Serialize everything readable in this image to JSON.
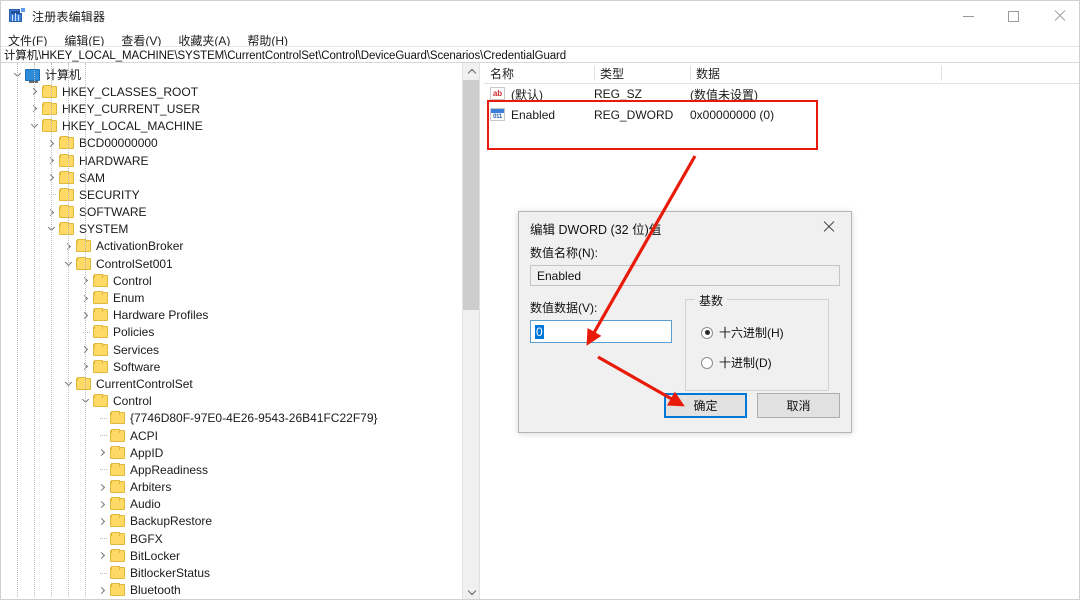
{
  "window": {
    "title": "注册表编辑器",
    "icon": "registry-editor-icon",
    "minimize_label": "最小化",
    "maximize_label": "最大化",
    "close_label": "关闭"
  },
  "menubar": {
    "items": [
      {
        "label": "文件(F)"
      },
      {
        "label": "编辑(E)"
      },
      {
        "label": "查看(V)"
      },
      {
        "label": "收藏夹(A)"
      },
      {
        "label": "帮助(H)"
      }
    ]
  },
  "address": {
    "path": "计算机\\HKEY_LOCAL_MACHINE\\SYSTEM\\CurrentControlSet\\Control\\DeviceGuard\\Scenarios\\CredentialGuard"
  },
  "tree": {
    "items": [
      {
        "label": "计算机",
        "depth": 0,
        "icon": "computer-icon",
        "state": "expanded"
      },
      {
        "label": "HKEY_CLASSES_ROOT",
        "depth": 1,
        "icon": "folder-icon",
        "state": "collapsed"
      },
      {
        "label": "HKEY_CURRENT_USER",
        "depth": 1,
        "icon": "folder-icon",
        "state": "collapsed"
      },
      {
        "label": "HKEY_LOCAL_MACHINE",
        "depth": 1,
        "icon": "folder-icon",
        "state": "expanded"
      },
      {
        "label": "BCD00000000",
        "depth": 2,
        "icon": "folder-icon",
        "state": "collapsed"
      },
      {
        "label": "HARDWARE",
        "depth": 2,
        "icon": "folder-icon",
        "state": "collapsed"
      },
      {
        "label": "SAM",
        "depth": 2,
        "icon": "folder-icon",
        "state": "collapsed"
      },
      {
        "label": "SECURITY",
        "depth": 2,
        "icon": "folder-icon",
        "state": "leaf"
      },
      {
        "label": "SOFTWARE",
        "depth": 2,
        "icon": "folder-icon",
        "state": "collapsed"
      },
      {
        "label": "SYSTEM",
        "depth": 2,
        "icon": "folder-icon",
        "state": "expanded"
      },
      {
        "label": "ActivationBroker",
        "depth": 3,
        "icon": "folder-icon",
        "state": "collapsed"
      },
      {
        "label": "ControlSet001",
        "depth": 3,
        "icon": "folder-icon",
        "state": "expanded"
      },
      {
        "label": "Control",
        "depth": 4,
        "icon": "folder-icon",
        "state": "collapsed"
      },
      {
        "label": "Enum",
        "depth": 4,
        "icon": "folder-icon",
        "state": "collapsed"
      },
      {
        "label": "Hardware Profiles",
        "depth": 4,
        "icon": "folder-icon",
        "state": "collapsed"
      },
      {
        "label": "Policies",
        "depth": 4,
        "icon": "folder-icon",
        "state": "leaf"
      },
      {
        "label": "Services",
        "depth": 4,
        "icon": "folder-icon",
        "state": "collapsed"
      },
      {
        "label": "Software",
        "depth": 4,
        "icon": "folder-icon",
        "state": "collapsed"
      },
      {
        "label": "CurrentControlSet",
        "depth": 3,
        "icon": "folder-icon",
        "state": "expanded"
      },
      {
        "label": "Control",
        "depth": 4,
        "icon": "folder-icon",
        "state": "expanded"
      },
      {
        "label": "{7746D80F-97E0-4E26-9543-26B41FC22F79}",
        "depth": 5,
        "icon": "folder-icon",
        "state": "leaf"
      },
      {
        "label": "ACPI",
        "depth": 5,
        "icon": "folder-icon",
        "state": "leaf"
      },
      {
        "label": "AppID",
        "depth": 5,
        "icon": "folder-icon",
        "state": "collapsed"
      },
      {
        "label": "AppReadiness",
        "depth": 5,
        "icon": "folder-icon",
        "state": "leaf"
      },
      {
        "label": "Arbiters",
        "depth": 5,
        "icon": "folder-icon",
        "state": "collapsed"
      },
      {
        "label": "Audio",
        "depth": 5,
        "icon": "folder-icon",
        "state": "collapsed"
      },
      {
        "label": "BackupRestore",
        "depth": 5,
        "icon": "folder-icon",
        "state": "collapsed"
      },
      {
        "label": "BGFX",
        "depth": 5,
        "icon": "folder-icon",
        "state": "leaf"
      },
      {
        "label": "BitLocker",
        "depth": 5,
        "icon": "folder-icon",
        "state": "collapsed"
      },
      {
        "label": "BitlockerStatus",
        "depth": 5,
        "icon": "folder-icon",
        "state": "leaf"
      },
      {
        "label": "Bluetooth",
        "depth": 5,
        "icon": "folder-icon",
        "state": "collapsed"
      }
    ]
  },
  "values": {
    "columns": [
      {
        "label": "名称"
      },
      {
        "label": "类型"
      },
      {
        "label": "数据"
      }
    ],
    "rows": [
      {
        "name": "(默认)",
        "type": "REG_SZ",
        "data": "(数值未设置)",
        "icon": "string-value-icon"
      },
      {
        "name": "Enabled",
        "type": "REG_DWORD",
        "data": "0x00000000 (0)",
        "icon": "dword-value-icon"
      }
    ]
  },
  "dialog": {
    "title": "编辑 DWORD (32 位)值",
    "name_label": "数值名称(N):",
    "name_value": "Enabled",
    "data_label": "数值数据(V):",
    "data_value": "0",
    "base_group_label": "基数",
    "base_options": [
      {
        "label": "十六进制(H)",
        "selected": true
      },
      {
        "label": "十进制(D)",
        "selected": false
      }
    ],
    "ok_label": "确定",
    "cancel_label": "取消",
    "close_label": "关闭"
  },
  "annotations": {
    "accent_color": "#e81b0b",
    "highlight_target": "Enabled 行",
    "arrow_1_target": "数值数据输入框",
    "arrow_2_target": "确定按钮"
  },
  "colors": {
    "accent": "#0078d7",
    "annotation": "#e81b0b",
    "folder": "#ffd966",
    "dialog_bg": "#f0f0f0"
  }
}
